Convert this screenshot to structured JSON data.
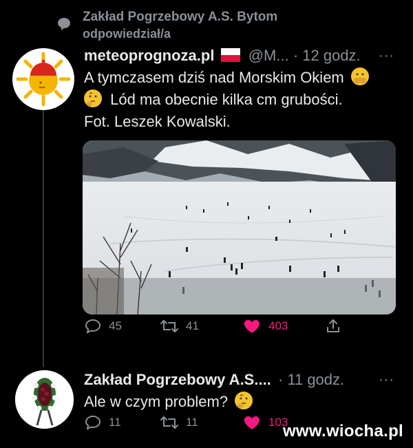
{
  "reply_context": {
    "account": "Zakład Pogrzebowy A.S. Bytom",
    "verb": "odpowiedział/a"
  },
  "tweet1": {
    "name": "meteoprognoza.pl",
    "handle": "@M...",
    "time": "· 12 godz.",
    "more": "···",
    "line1": "A tymczasem dziś nad Morskim Okiem",
    "line2": "Lód ma obecnie kilka cm grubości.",
    "line3": "Fot. Leszek Kowalski.",
    "replies": "45",
    "retweets": "41",
    "likes": "403",
    "liked": true
  },
  "tweet2": {
    "name": "Zakład Pogrzebowy A.S....",
    "time": "· 11 godz.",
    "more": "···",
    "text": "Ale w czym problem?",
    "replies": "11",
    "retweets": "11",
    "likes": "103",
    "liked": true
  },
  "watermark": "www.wiocha.pl",
  "colors": {
    "background": "#000000",
    "like": "#f91880",
    "muted": "#8b9197",
    "text": "#e7e9ea"
  },
  "icons": {
    "reply_context": "speech-bubble-icon",
    "flag": "poland-flag-icon",
    "emoji_1": "face-with-hand-over-mouth-emoji",
    "emoji_2": "thinking-face-emoji"
  }
}
